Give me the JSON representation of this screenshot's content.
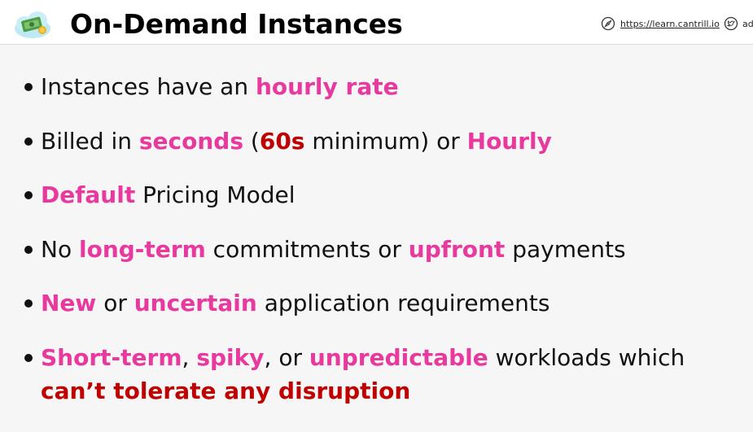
{
  "header": {
    "title": "On-Demand Instances",
    "link_text": "https://learn.cantrill.io",
    "twitter_text": "ad",
    "logo_icon": "money-cloud-icon",
    "link_icon": "compass-icon",
    "twitter_icon": "twitter-icon"
  },
  "colors": {
    "highlight_pink": "#e8399f",
    "highlight_red": "#c00000",
    "text": "#111111",
    "background": "#f6f6f6"
  },
  "bullets": [
    {
      "segments": [
        {
          "text": "Instances have an ",
          "style": "plain"
        },
        {
          "text": "hourly rate",
          "style": "pink"
        }
      ]
    },
    {
      "segments": [
        {
          "text": "Billed in ",
          "style": "plain"
        },
        {
          "text": "seconds",
          "style": "pink"
        },
        {
          "text": " (",
          "style": "plain"
        },
        {
          "text": "60s",
          "style": "red"
        },
        {
          "text": " minimum) or ",
          "style": "plain"
        },
        {
          "text": "Hourly",
          "style": "pink"
        }
      ]
    },
    {
      "segments": [
        {
          "text": "Default",
          "style": "pink"
        },
        {
          "text": " Pricing Model",
          "style": "plain"
        }
      ]
    },
    {
      "segments": [
        {
          "text": "No ",
          "style": "plain"
        },
        {
          "text": "long-term",
          "style": "pink"
        },
        {
          "text": " commitments or ",
          "style": "plain"
        },
        {
          "text": "upfront",
          "style": "pink"
        },
        {
          "text": " payments",
          "style": "plain"
        }
      ]
    },
    {
      "segments": [
        {
          "text": "New",
          "style": "pink"
        },
        {
          "text": " or ",
          "style": "plain"
        },
        {
          "text": "uncertain",
          "style": "pink"
        },
        {
          "text": " application requirements",
          "style": "plain"
        }
      ]
    },
    {
      "segments": [
        {
          "text": "Short-term",
          "style": "pink"
        },
        {
          "text": ", ",
          "style": "plain"
        },
        {
          "text": "spiky",
          "style": "pink"
        },
        {
          "text": ", or ",
          "style": "plain"
        },
        {
          "text": "unpredictable",
          "style": "pink"
        },
        {
          "text": " workloads which ",
          "style": "plain"
        },
        {
          "text": "can’t tolerate any disruption",
          "style": "red"
        }
      ]
    }
  ]
}
